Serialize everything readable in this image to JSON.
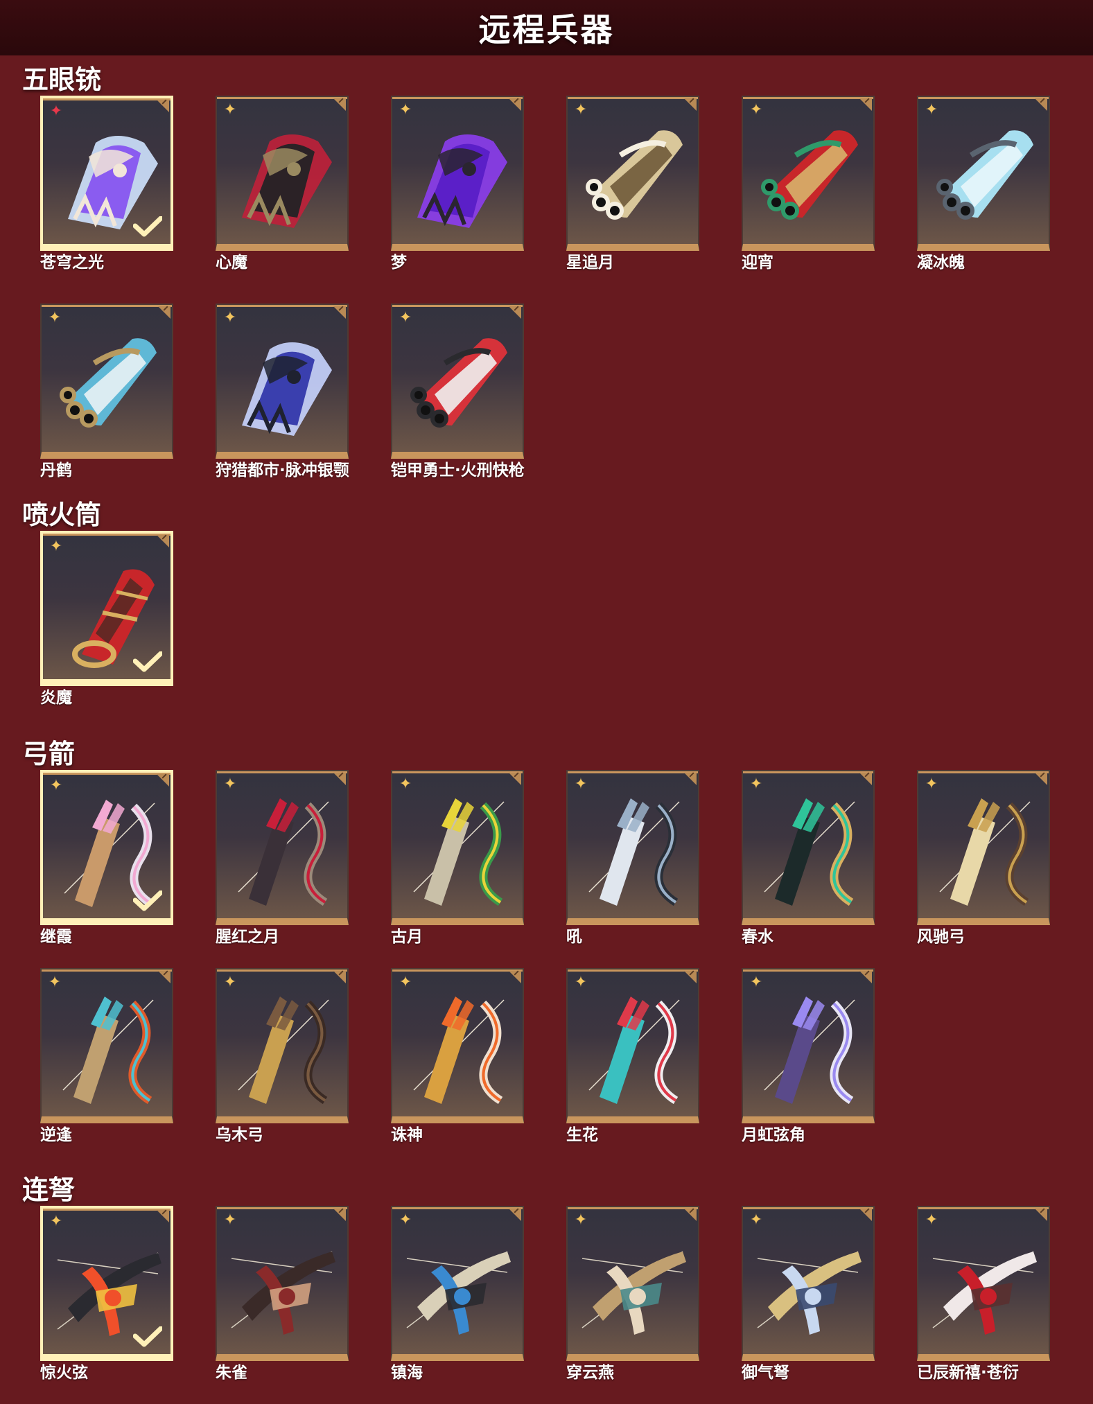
{
  "page_title": "远程兵器",
  "colors": {
    "background": "#671a1f",
    "header": "#2f090c",
    "card_frame": "#c9965d",
    "selected_frame": "#fff0b8",
    "rarity_gold": "#f3c55e",
    "rarity_red": "#e8384a"
  },
  "sections": [
    {
      "title": "五眼铳",
      "items": [
        {
          "name": "苍穹之光",
          "selected": true,
          "rarity": "red",
          "art": "glove",
          "palette": [
            "#8a5cf0",
            "#cfe3ff",
            "#f2e6d8"
          ]
        },
        {
          "name": "心魔",
          "selected": false,
          "rarity": "gold",
          "art": "glove",
          "palette": [
            "#2b2226",
            "#c0203a",
            "#9a8a60"
          ]
        },
        {
          "name": "梦",
          "selected": false,
          "rarity": "gold",
          "art": "glove",
          "palette": [
            "#5b1fc8",
            "#8c3df0",
            "#2a2530"
          ]
        },
        {
          "name": "星追月",
          "selected": false,
          "rarity": "gold",
          "art": "cannon",
          "palette": [
            "#d9c79a",
            "#6f5a3a",
            "#f5efe0"
          ]
        },
        {
          "name": "迎宵",
          "selected": false,
          "rarity": "gold",
          "art": "cannon",
          "palette": [
            "#c8262a",
            "#d7b36a",
            "#2f9a6a"
          ]
        },
        {
          "name": "凝冰魄",
          "selected": false,
          "rarity": "gold",
          "art": "cannon",
          "palette": [
            "#a7dff0",
            "#e8f6fb",
            "#5a6470"
          ]
        },
        {
          "name": "丹鹤",
          "selected": false,
          "rarity": "gold",
          "art": "cannon",
          "palette": [
            "#5fb8d6",
            "#e9f2f5",
            "#b89a60"
          ]
        },
        {
          "name": "狩猎都市·脉冲银颚",
          "selected": false,
          "rarity": "gold",
          "art": "glove",
          "palette": [
            "#3a3fae",
            "#c8d4ff",
            "#1f2230"
          ]
        },
        {
          "name": "铠甲勇士·火刑快枪",
          "selected": false,
          "rarity": "gold",
          "art": "cannon",
          "palette": [
            "#d6323a",
            "#f0f0f0",
            "#2a2a2e"
          ]
        }
      ]
    },
    {
      "title": "喷火筒",
      "items": [
        {
          "name": "炎魔",
          "selected": true,
          "rarity": "gold",
          "art": "tube",
          "palette": [
            "#c8262a",
            "#d9b060",
            "#3a2a22"
          ]
        }
      ]
    },
    {
      "title": "弓箭",
      "items": [
        {
          "name": "继霞",
          "selected": true,
          "rarity": "gold",
          "art": "bow",
          "palette": [
            "#f2a9d2",
            "#e8e0ec",
            "#c99a6a"
          ]
        },
        {
          "name": "腥红之月",
          "selected": false,
          "rarity": "gold",
          "art": "bow",
          "palette": [
            "#c81f3a",
            "#9c8a7a",
            "#3a3038"
          ]
        },
        {
          "name": "古月",
          "selected": false,
          "rarity": "gold",
          "art": "bow",
          "palette": [
            "#e8d43a",
            "#3a9a4a",
            "#c9c0a8"
          ]
        },
        {
          "name": "吼",
          "selected": false,
          "rarity": "gold",
          "art": "bow",
          "palette": [
            "#9ab0c8",
            "#2a2f38",
            "#e0e6ee"
          ]
        },
        {
          "name": "春水",
          "selected": false,
          "rarity": "gold",
          "art": "bow",
          "palette": [
            "#2fc49a",
            "#d9b060",
            "#1c2a2a"
          ]
        },
        {
          "name": "风驰弓",
          "selected": false,
          "rarity": "gold",
          "art": "bow",
          "palette": [
            "#c9a050",
            "#5a4030",
            "#e8d8a8"
          ]
        },
        {
          "name": "逆逢",
          "selected": false,
          "rarity": "gold",
          "art": "bow",
          "palette": [
            "#4fc0d0",
            "#e05a2a",
            "#c0a070"
          ]
        },
        {
          "name": "乌木弓",
          "selected": false,
          "rarity": "gold",
          "art": "bow",
          "palette": [
            "#7a5a40",
            "#3a2a24",
            "#c9a050"
          ]
        },
        {
          "name": "诛神",
          "selected": false,
          "rarity": "gold",
          "art": "bow",
          "palette": [
            "#f06a2a",
            "#f0e0d0",
            "#d9a040"
          ]
        },
        {
          "name": "生花",
          "selected": false,
          "rarity": "gold",
          "art": "bow",
          "palette": [
            "#e03a4a",
            "#f0eef0",
            "#3ac0c0"
          ]
        },
        {
          "name": "月虹弦角",
          "selected": false,
          "rarity": "gold",
          "art": "bow",
          "palette": [
            "#9a8af0",
            "#e8e6f5",
            "#5a4a8a"
          ]
        }
      ]
    },
    {
      "title": "连弩",
      "items": [
        {
          "name": "惊火弦",
          "selected": true,
          "rarity": "gold",
          "art": "crossbow",
          "palette": [
            "#f0502a",
            "#2a2a30",
            "#f0c040"
          ]
        },
        {
          "name": "朱雀",
          "selected": false,
          "rarity": "gold",
          "art": "crossbow",
          "palette": [
            "#8a2a2a",
            "#3a2a28",
            "#d0a080"
          ]
        },
        {
          "name": "镇海",
          "selected": false,
          "rarity": "gold",
          "art": "crossbow",
          "palette": [
            "#3a8ad0",
            "#d9d0b8",
            "#2a2a30"
          ]
        },
        {
          "name": "穿云燕",
          "selected": false,
          "rarity": "gold",
          "art": "crossbow",
          "palette": [
            "#e8d8c0",
            "#c0a070",
            "#4a8a8a"
          ]
        },
        {
          "name": "御气弩",
          "selected": false,
          "rarity": "gold",
          "art": "crossbow",
          "palette": [
            "#c8d8f0",
            "#d9c080",
            "#3a4a70"
          ]
        },
        {
          "name": "已辰新禧·苍衍",
          "selected": false,
          "rarity": "gold",
          "art": "crossbow",
          "palette": [
            "#c81f2a",
            "#f0e8e8",
            "#5a3030"
          ]
        }
      ]
    }
  ]
}
